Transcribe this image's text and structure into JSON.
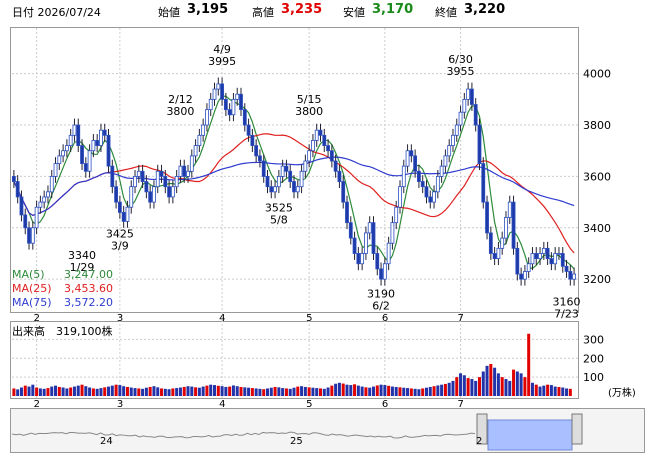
{
  "header": {
    "date_label": "日付 2026/07/24",
    "open_label": "始値",
    "open_value": "3,195",
    "high_label": "高値",
    "high_value": "3,235",
    "low_label": "安値",
    "low_value": "3,170",
    "close_label": "終値",
    "close_value": "3,220"
  },
  "colors": {
    "up": "#2b4fbf",
    "down": "#1f3aa8",
    "ma5": "#2e8b3a",
    "ma25": "#e02020",
    "ma75": "#2f3ccf",
    "high": "#e00000",
    "low": "#1a8a1a",
    "volume": "#2233aa",
    "volume_spike": "#e00000",
    "grid": "#cccccc"
  },
  "legend": {
    "ma5_label": "MA(5)",
    "ma5_value": "3,247.00",
    "ma25_label": "MA(25)",
    "ma25_value": "3,453.60",
    "ma75_label": "MA(75)",
    "ma75_value": "3,572.20"
  },
  "volume_panel": {
    "label": "出来高",
    "value": "319,100株",
    "unit": "(万株)"
  },
  "navigator": {
    "labels": [
      "24",
      "25",
      "2"
    ]
  },
  "chart_data": {
    "type": "candlestick",
    "y_axis": {
      "ticks": [
        3200,
        3400,
        3600,
        3800,
        4000
      ],
      "min": 3080,
      "max": 4170
    },
    "x_axis": {
      "month_labels": [
        "2",
        "3",
        "4",
        "5",
        "6",
        "7"
      ]
    },
    "annotations": [
      {
        "date": "1/29",
        "value": 3340
      },
      {
        "date": "2/12",
        "value": 3800
      },
      {
        "date": "3/9",
        "value": 3425
      },
      {
        "date": "4/9",
        "value": 3995
      },
      {
        "date": "5/15",
        "value": 3800
      },
      {
        "date": "5/8",
        "value": 3525
      },
      {
        "date": "6/2",
        "value": 3190
      },
      {
        "date": "6/30",
        "value": 3955
      },
      {
        "date": "7/23",
        "value": 3160
      }
    ],
    "volume_axis": {
      "ticks": [
        100,
        200,
        300
      ],
      "max": 350
    },
    "close": [
      3580,
      3520,
      3450,
      3400,
      3340,
      3400,
      3480,
      3500,
      3520,
      3540,
      3600,
      3650,
      3680,
      3700,
      3720,
      3760,
      3800,
      3720,
      3650,
      3620,
      3700,
      3740,
      3720,
      3780,
      3760,
      3640,
      3560,
      3500,
      3460,
      3425,
      3480,
      3560,
      3600,
      3620,
      3580,
      3540,
      3500,
      3560,
      3620,
      3600,
      3560,
      3520,
      3560,
      3600,
      3640,
      3600,
      3620,
      3680,
      3720,
      3760,
      3800,
      3860,
      3900,
      3940,
      3960,
      3900,
      3860,
      3840,
      3900,
      3920,
      3860,
      3800,
      3760,
      3720,
      3680,
      3660,
      3600,
      3560,
      3540,
      3560,
      3600,
      3640,
      3620,
      3580,
      3540,
      3560,
      3620,
      3660,
      3700,
      3740,
      3780,
      3760,
      3720,
      3700,
      3660,
      3620,
      3580,
      3500,
      3420,
      3360,
      3300,
      3260,
      3300,
      3380,
      3420,
      3300,
      3240,
      3200,
      3260,
      3340,
      3420,
      3480,
      3560,
      3640,
      3700,
      3680,
      3620,
      3580,
      3560,
      3520,
      3500,
      3540,
      3600,
      3640,
      3680,
      3720,
      3760,
      3800,
      3850,
      3900,
      3940,
      3880,
      3800,
      3650,
      3500,
      3380,
      3300,
      3280,
      3320,
      3360,
      3440,
      3500,
      3320,
      3220,
      3200,
      3230,
      3260,
      3300,
      3280,
      3300,
      3320,
      3280,
      3260,
      3300,
      3300,
      3250,
      3230,
      3200,
      3220
    ],
    "volume": [
      40,
      35,
      45,
      55,
      50,
      60,
      45,
      40,
      38,
      42,
      50,
      55,
      48,
      45,
      40,
      45,
      50,
      55,
      60,
      52,
      45,
      40,
      38,
      42,
      46,
      50,
      55,
      60,
      58,
      52,
      48,
      45,
      42,
      40,
      38,
      44,
      48,
      52,
      46,
      40,
      38,
      36,
      40,
      42,
      45,
      48,
      52,
      50,
      46,
      44,
      50,
      55,
      60,
      58,
      54,
      52,
      48,
      50,
      56,
      52,
      48,
      46,
      44,
      42,
      40,
      38,
      36,
      40,
      44,
      48,
      46,
      42,
      40,
      38,
      44,
      50,
      52,
      48,
      46,
      44,
      42,
      40,
      38,
      45,
      55,
      65,
      70,
      66,
      60,
      58,
      62,
      55,
      50,
      46,
      44,
      50,
      56,
      60,
      58,
      54,
      50,
      48,
      46,
      44,
      42,
      40,
      38,
      36,
      40,
      44,
      48,
      52,
      56,
      60,
      64,
      70,
      80,
      100,
      120,
      110,
      95,
      90,
      80,
      100,
      130,
      160,
      170,
      150,
      120,
      100,
      90,
      80,
      140,
      130,
      120,
      100,
      330,
      70,
      60,
      50,
      55,
      60,
      58,
      50,
      48,
      45,
      40,
      38
    ]
  }
}
